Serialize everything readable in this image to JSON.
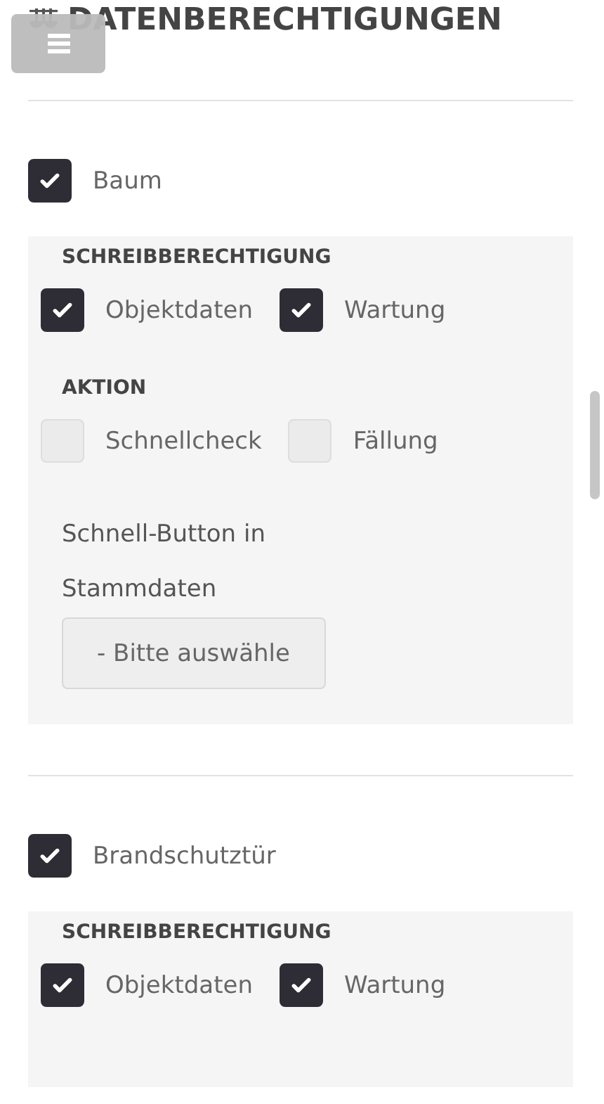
{
  "header": {
    "title": "DATENBERECHTIGUNGEN"
  },
  "sections": [
    {
      "name": "Baum",
      "checked": true,
      "groups": [
        {
          "title": "SCHREIBBERECHTIGUNG",
          "items": [
            {
              "label": "Objektdaten",
              "checked": true
            },
            {
              "label": "Wartung",
              "checked": true
            }
          ]
        },
        {
          "title": "AKTION",
          "items": [
            {
              "label": "Schnellcheck",
              "checked": false
            },
            {
              "label": "Fällung",
              "checked": false
            }
          ]
        }
      ],
      "select": {
        "label": "Schnell-Button in Stammdaten",
        "value": "- Bitte auswähle"
      }
    },
    {
      "name": "Brandschutztür",
      "checked": true,
      "groups": [
        {
          "title": "SCHREIBBERECHTIGUNG",
          "items": [
            {
              "label": "Objektdaten",
              "checked": true
            },
            {
              "label": "Wartung",
              "checked": true
            }
          ]
        }
      ]
    }
  ]
}
